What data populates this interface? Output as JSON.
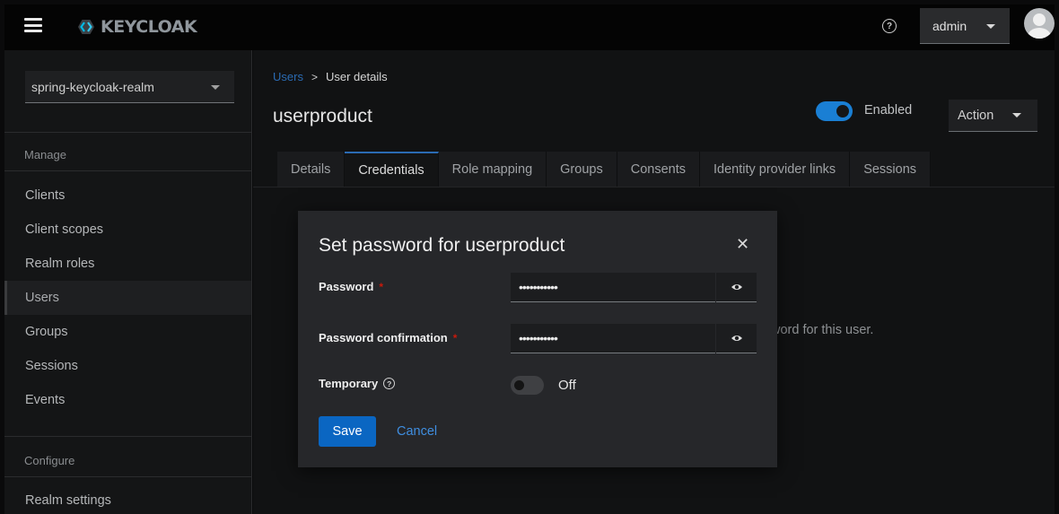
{
  "topbar": {
    "logo_prefix": "",
    "logo_text": "KEYCLOAK",
    "user_label": "admin"
  },
  "sidebar": {
    "realm": "spring-keycloak-realm",
    "manage_label": "Manage",
    "configure_label": "Configure",
    "manage_items": [
      "Clients",
      "Client scopes",
      "Realm roles",
      "Users",
      "Groups",
      "Sessions",
      "Events"
    ],
    "configure_items": [
      "Realm settings"
    ],
    "active_item": "Users"
  },
  "main": {
    "breadcrumb": {
      "parent": "Users",
      "current": "User details"
    },
    "title": "userproduct",
    "enabled_label": "Enabled",
    "action_label": "Action",
    "tabs": [
      "Details",
      "Credentials",
      "Role mapping",
      "Groups",
      "Consents",
      "Identity provider links",
      "Sessions"
    ],
    "active_tab": "Credentials",
    "background_text": "word for this user."
  },
  "modal": {
    "title": "Set password for userproduct",
    "password_label": "Password",
    "password_value": "•••••••••••",
    "confirm_label": "Password confirmation",
    "confirm_value": "•••••••••••",
    "temporary_label": "Temporary",
    "temporary_state": "Off",
    "save_label": "Save",
    "cancel_label": "Cancel"
  },
  "colors": {
    "accent": "#0a66c2",
    "link": "#3f8ee0",
    "required": "#c9190b"
  }
}
